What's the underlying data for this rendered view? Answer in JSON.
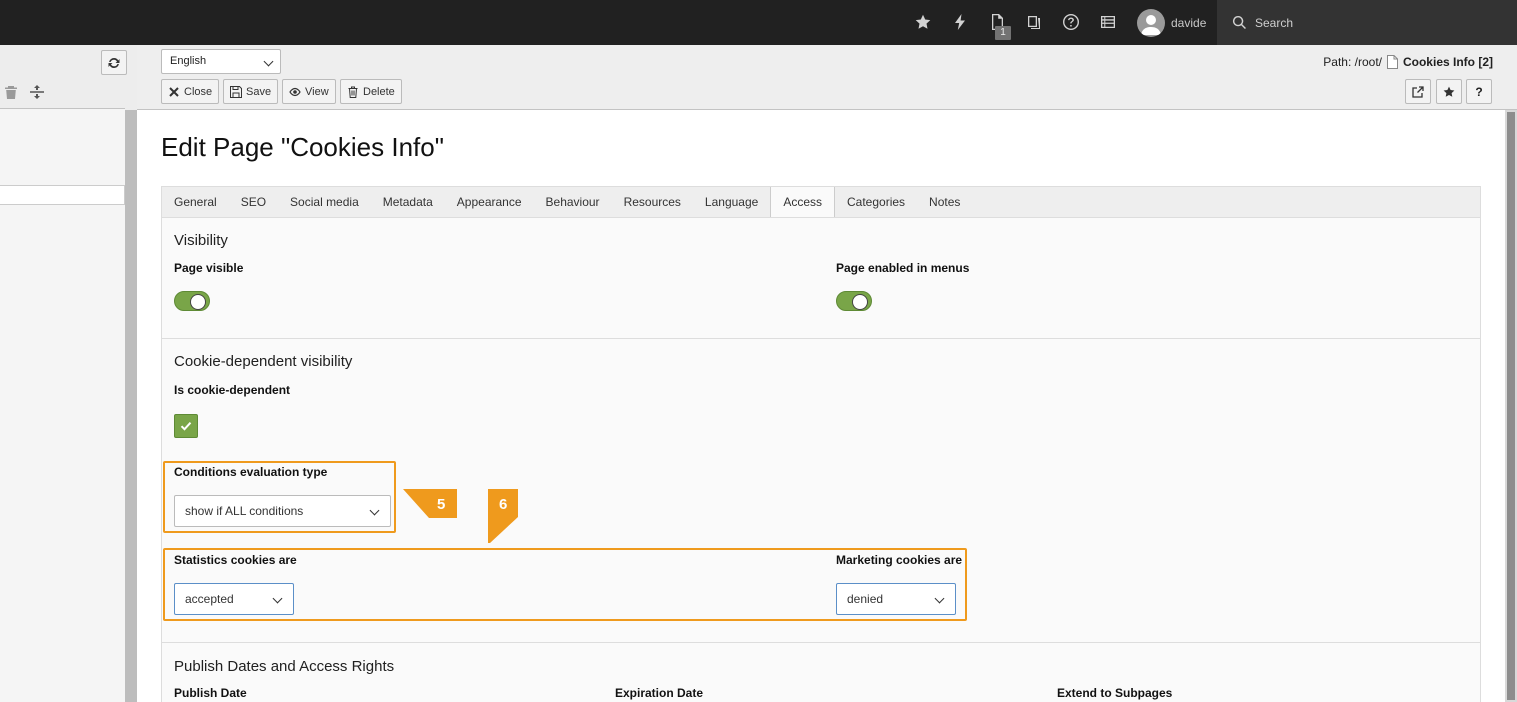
{
  "topbar": {
    "username": "davide",
    "search_placeholder": "Search",
    "opendocs_count": "1"
  },
  "docheader": {
    "language": "English",
    "path_label": "Path: /root/",
    "path_page": "Cookies Info [2]",
    "buttons": {
      "close": "Close",
      "save": "Save",
      "view": "View",
      "delete": "Delete"
    },
    "help_label": "?"
  },
  "page": {
    "title": "Edit Page \"Cookies Info\"",
    "tabs": [
      "General",
      "SEO",
      "Social media",
      "Metadata",
      "Appearance",
      "Behaviour",
      "Resources",
      "Language",
      "Access",
      "Categories",
      "Notes"
    ],
    "active_tab": "Access"
  },
  "visibility": {
    "title": "Visibility",
    "page_visible_label": "Page visible",
    "page_visible": true,
    "menus_label": "Page enabled in menus",
    "menus_enabled": true
  },
  "cookie": {
    "title": "Cookie-dependent visibility",
    "is_dependent_label": "Is cookie-dependent",
    "is_dependent": true,
    "conditions_label": "Conditions evaluation type",
    "conditions_value": "show if ALL conditions",
    "statistics_label": "Statistics cookies are",
    "statistics_value": "accepted",
    "marketing_label": "Marketing cookies are",
    "marketing_value": "denied"
  },
  "publish": {
    "title": "Publish Dates and Access Rights",
    "publish_date_label": "Publish Date",
    "expiration_label": "Expiration Date",
    "extend_label": "Extend to Subpages"
  },
  "annotations": {
    "marker5": "5",
    "marker6": "6",
    "color": "#ef9a1d"
  }
}
